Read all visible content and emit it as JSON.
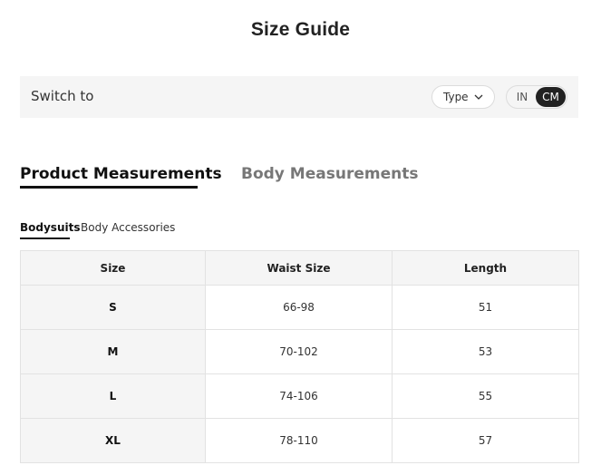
{
  "page": {
    "title": "Size Guide"
  },
  "switch_bar": {
    "label": "Switch to",
    "type_select": "Type",
    "units": {
      "in": "IN",
      "cm": "CM",
      "selected": "CM"
    }
  },
  "main_tabs": [
    {
      "label": "Product Measurements",
      "active": true
    },
    {
      "label": "Body Measurements",
      "active": false
    }
  ],
  "sub_tabs": [
    {
      "label": "Bodysuits",
      "active": true
    },
    {
      "label": "Body Accessories",
      "active": false
    }
  ],
  "table": {
    "headers": [
      "Size",
      "Waist Size",
      "Length"
    ],
    "rows": [
      [
        "S",
        "66-98",
        "51"
      ],
      [
        "M",
        "70-102",
        "53"
      ],
      [
        "L",
        "74-106",
        "55"
      ],
      [
        "XL",
        "78-110",
        "57"
      ]
    ]
  },
  "icons": {
    "type_select": "chevron-down-icon"
  }
}
